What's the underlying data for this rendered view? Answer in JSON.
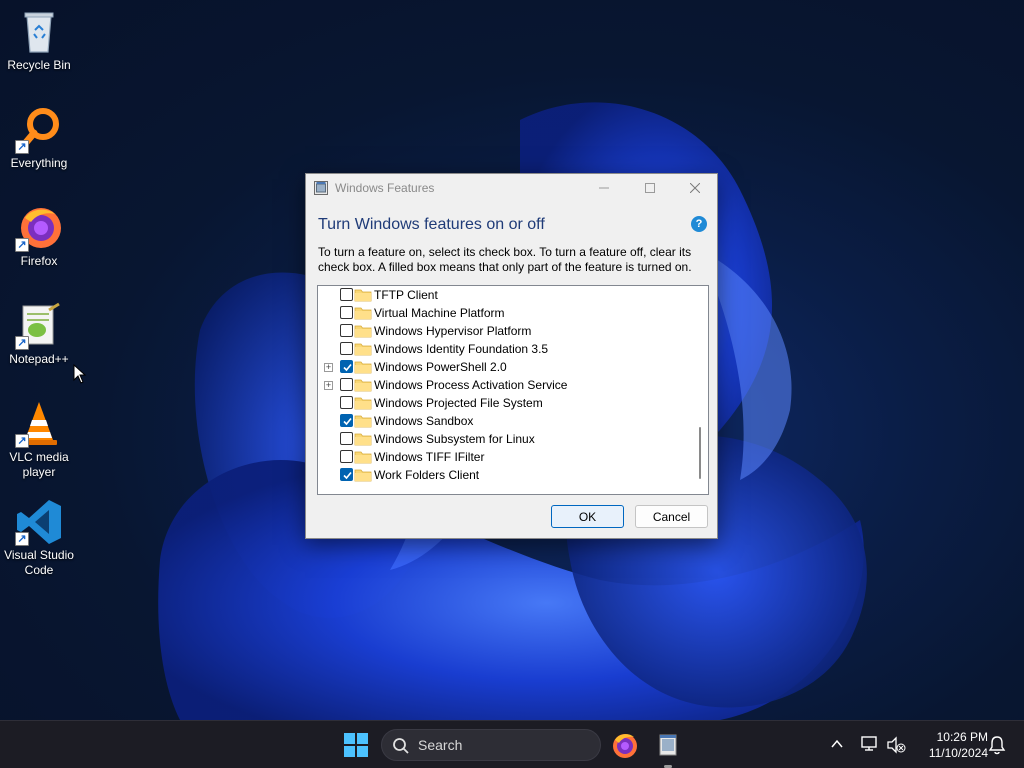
{
  "desktop": {
    "icons": [
      {
        "label": "Recycle Bin",
        "icon": "recycle-bin-icon"
      },
      {
        "label": "Everything",
        "icon": "everything-search-icon"
      },
      {
        "label": "Firefox",
        "icon": "firefox-icon"
      },
      {
        "label": "Notepad++",
        "icon": "notepad-plus-plus-icon"
      },
      {
        "label": "VLC media player",
        "icon": "vlc-icon"
      },
      {
        "label": "Visual Studio Code",
        "icon": "vscode-icon"
      }
    ]
  },
  "dialog": {
    "title": "Windows Features",
    "heading": "Turn Windows features on or off",
    "help_glyph": "?",
    "instructions": "To turn a feature on, select its check box. To turn a feature off, clear its check box. A filled box means that only part of the feature is turned on.",
    "features": [
      {
        "label": "TFTP Client",
        "checked": false,
        "expandable": false
      },
      {
        "label": "Virtual Machine Platform",
        "checked": false,
        "expandable": false
      },
      {
        "label": "Windows Hypervisor Platform",
        "checked": false,
        "expandable": false
      },
      {
        "label": "Windows Identity Foundation 3.5",
        "checked": false,
        "expandable": false
      },
      {
        "label": "Windows PowerShell 2.0",
        "checked": true,
        "expandable": true
      },
      {
        "label": "Windows Process Activation Service",
        "checked": false,
        "expandable": true
      },
      {
        "label": "Windows Projected File System",
        "checked": false,
        "expandable": false
      },
      {
        "label": "Windows Sandbox",
        "checked": true,
        "expandable": false
      },
      {
        "label": "Windows Subsystem for Linux",
        "checked": false,
        "expandable": false
      },
      {
        "label": "Windows TIFF IFilter",
        "checked": false,
        "expandable": false
      },
      {
        "label": "Work Folders Client",
        "checked": true,
        "expandable": false
      }
    ],
    "ok_label": "OK",
    "cancel_label": "Cancel"
  },
  "taskbar": {
    "search_label": "Search",
    "time": "10:26 PM",
    "date": "11/10/2024"
  },
  "colors": {
    "accent": "#0063b1",
    "heading": "#1f3b78",
    "taskbar": "#1c1c24"
  }
}
